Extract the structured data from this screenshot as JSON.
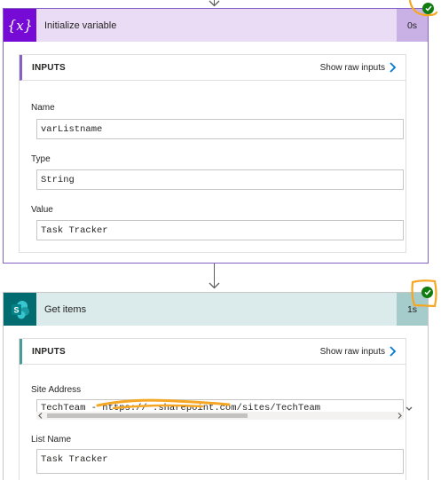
{
  "flow": {
    "steps": [
      {
        "title": "Initialize variable",
        "duration": "0s",
        "icon": "variable-icon",
        "status": "succeeded",
        "inputs": {
          "section_title": "INPUTS",
          "raw_link": "Show raw inputs",
          "fields": [
            {
              "label": "Name",
              "value": "varListname"
            },
            {
              "label": "Type",
              "value": "String"
            },
            {
              "label": "Value",
              "value": "Task Tracker"
            }
          ]
        }
      },
      {
        "title": "Get items",
        "duration": "1s",
        "icon": "sharepoint-icon",
        "status": "succeeded",
        "inputs": {
          "section_title": "INPUTS",
          "raw_link": "Show raw inputs",
          "fields": [
            {
              "label": "Site Address",
              "value": "TechTeam - https://                    .sharepoint.com/sites/TechTeam"
            },
            {
              "label": "List Name",
              "value": "Task Tracker"
            }
          ]
        }
      }
    ]
  },
  "colors": {
    "variable_accent": "#770bd6",
    "variable_header": "#ebdcf5",
    "sharepoint_accent": "#036c70",
    "sharepoint_header": "#dbebeb",
    "success": "#107c10",
    "highlight_annotation": "#f5a623",
    "link_chevron": "#0078d4"
  }
}
